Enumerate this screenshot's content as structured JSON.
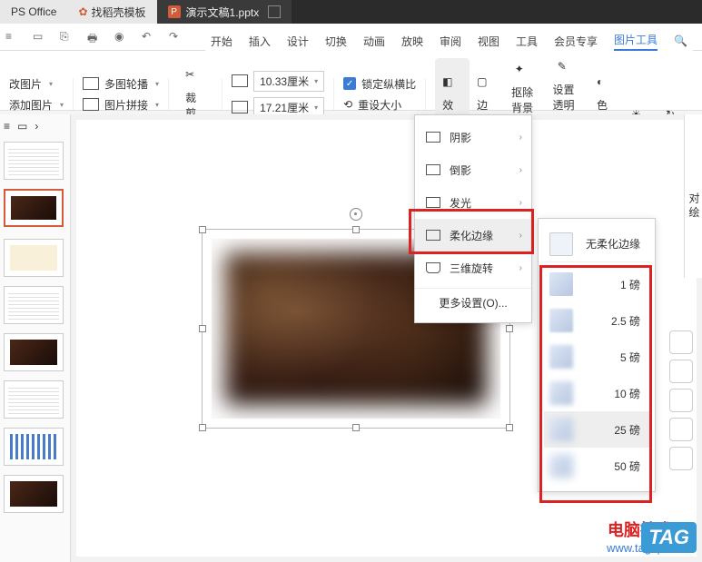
{
  "tabs": {
    "office": "PS Office",
    "template": "找稻壳模板",
    "doc": "演示文稿1.pptx"
  },
  "menu": {
    "start": "开始",
    "insert": "插入",
    "design": "设计",
    "switch": "切换",
    "anim": "动画",
    "play": "放映",
    "review": "审阅",
    "view": "视图",
    "tool": "工具",
    "member": "会员专享",
    "pictool": "图片工具"
  },
  "ribbon": {
    "change": "改图片",
    "multi": "多图轮播",
    "add": "添加图片",
    "join": "图片拼接",
    "crop": "裁剪",
    "w": "10.33厘米",
    "h": "17.21厘米",
    "lock": "锁定纵横比",
    "reset": "重设大小",
    "effect": "效果",
    "border": "边框",
    "removebg": "抠除背景",
    "transparent": "设置透明色",
    "color": "色彩"
  },
  "fx": {
    "shadow": "阴影",
    "reflect": "倒影",
    "glow": "发光",
    "soft": "柔化边缘",
    "rot3d": "三维旋转",
    "more": "更多设置(O)..."
  },
  "soft": {
    "none": "无柔化边缘",
    "p1": "1 磅",
    "p25": "2.5 磅",
    "p5": "5 磅",
    "p10": "10 磅",
    "p25b": "25 磅",
    "p50": "50 磅"
  },
  "rpanel": {
    "label": "对 绘"
  },
  "wm": {
    "t1": "电脑技术网",
    "t2": "www.tagxp.com",
    "tag": "TAG"
  }
}
